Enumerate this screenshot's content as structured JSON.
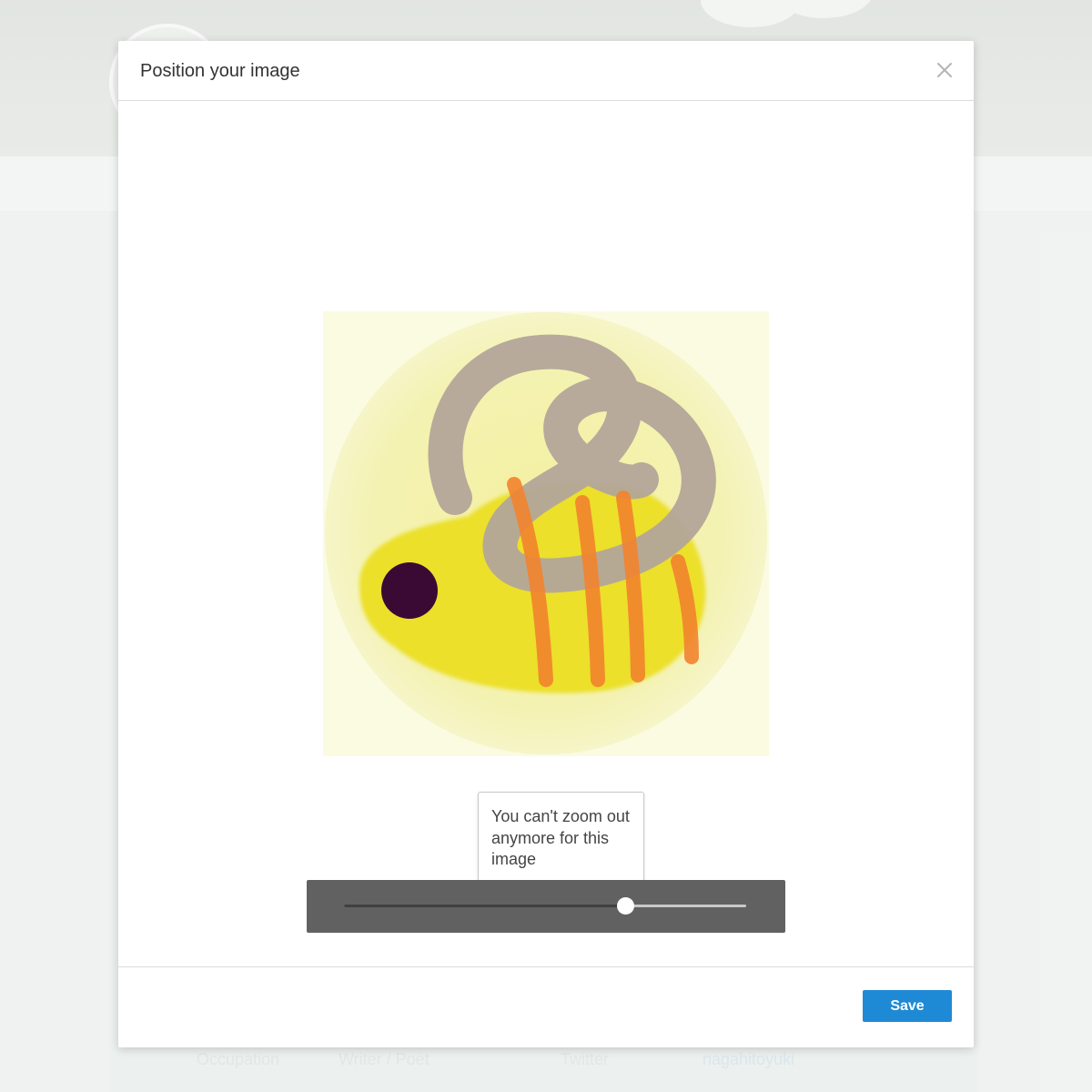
{
  "modal": {
    "title": "Position your image",
    "close_icon": "close-icon"
  },
  "zoom": {
    "tooltip": "You can't zoom out anymore for this image",
    "level": 0.7
  },
  "footer": {
    "save_label": "Save"
  },
  "background_page": {
    "occupation_label": "Occupation",
    "occupation_value": "Writer / Poet",
    "twitter_label": "Twitter",
    "twitter_value": "nagahitoyuki"
  },
  "colors": {
    "primary_button": "#1e8ad6",
    "zoom_bar": "#616161"
  }
}
